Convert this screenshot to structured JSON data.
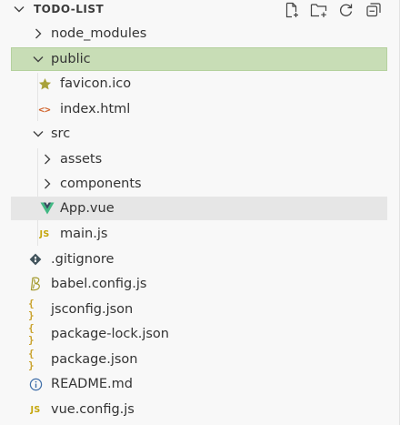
{
  "explorer": {
    "title": "TODO-LIST",
    "actions": [
      {
        "name": "new-file-icon"
      },
      {
        "name": "new-folder-icon"
      },
      {
        "name": "refresh-icon"
      },
      {
        "name": "collapse-all-icon"
      }
    ]
  },
  "tree": [
    {
      "label": "node_modules",
      "kind": "folder",
      "state": "collapsed",
      "icon": "chevron-right-icon"
    },
    {
      "label": "public",
      "kind": "folder",
      "state": "expanded",
      "selected": true,
      "icon": "chevron-down-icon"
    },
    {
      "label": "favicon.ico",
      "kind": "file",
      "icon": "star-icon"
    },
    {
      "label": "index.html",
      "kind": "file",
      "icon": "html-icon"
    },
    {
      "label": "src",
      "kind": "folder",
      "state": "expanded",
      "icon": "chevron-down-icon"
    },
    {
      "label": "assets",
      "kind": "folder",
      "state": "collapsed",
      "icon": "chevron-right-icon"
    },
    {
      "label": "components",
      "kind": "folder",
      "state": "collapsed",
      "icon": "chevron-right-icon"
    },
    {
      "label": "App.vue",
      "kind": "file",
      "hovered": true,
      "icon": "vue-icon"
    },
    {
      "label": "main.js",
      "kind": "file",
      "icon": "js-icon"
    },
    {
      "label": ".gitignore",
      "kind": "file",
      "icon": "git-icon"
    },
    {
      "label": "babel.config.js",
      "kind": "file",
      "icon": "babel-icon"
    },
    {
      "label": "jsconfig.json",
      "kind": "file",
      "icon": "json-icon"
    },
    {
      "label": "package-lock.json",
      "kind": "file",
      "icon": "json-icon"
    },
    {
      "label": "package.json",
      "kind": "file",
      "icon": "json-icon"
    },
    {
      "label": "README.md",
      "kind": "file",
      "icon": "info-icon"
    },
    {
      "label": "vue.config.js",
      "kind": "file",
      "icon": "js-icon"
    }
  ],
  "icon_glyphs": {
    "js": "JS",
    "json": "{ }",
    "html": "<>"
  },
  "colors": {
    "selected_bg": "#c8ddb6",
    "hover_bg": "#e6e6e6",
    "vue_green": "#41b883",
    "js_yellow": "#c5a60a",
    "json_yellow": "#c9a12a",
    "html_orange": "#d1622a",
    "star_olive": "#a9a23a"
  }
}
